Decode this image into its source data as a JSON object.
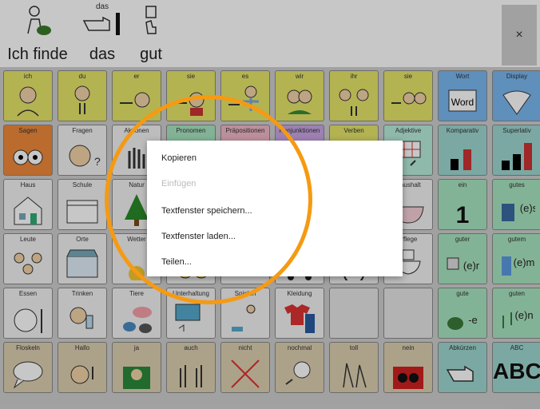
{
  "message_bar": {
    "words": [
      {
        "text": "Ich finde",
        "small": "",
        "icon": "finder-person-icon"
      },
      {
        "text": "das",
        "small": "das",
        "icon": "pointing-hand-icon"
      },
      {
        "text": "gut",
        "small": "",
        "icon": "thumb-up-icon"
      }
    ],
    "close_label": "×"
  },
  "grid": {
    "rows": [
      [
        {
          "label": "ich",
          "color": "yellow",
          "icon": "person-self-icon"
        },
        {
          "label": "du",
          "color": "yellow",
          "icon": "person-you-icon"
        },
        {
          "label": "er",
          "color": "yellow",
          "icon": "point-boy-icon"
        },
        {
          "label": "sie",
          "color": "yellow",
          "icon": "point-girl-icon"
        },
        {
          "label": "es",
          "color": "yellow",
          "icon": "point-child-icon"
        },
        {
          "label": "wir",
          "color": "yellow",
          "icon": "group-we-icon"
        },
        {
          "label": "ihr",
          "color": "yellow",
          "icon": "group-you-icon"
        },
        {
          "label": "sie",
          "color": "yellow",
          "icon": "group-they-icon"
        },
        {
          "label": "Wort",
          "color": "blue",
          "icon": "word-card-icon"
        },
        {
          "label": "Display",
          "color": "blue",
          "icon": "fan-display-icon"
        }
      ],
      [
        {
          "label": "Sagen",
          "color": "orange",
          "icon": "look-eyes-icon"
        },
        {
          "label": "Fragen",
          "color": "white",
          "icon": "question-face-icon"
        },
        {
          "label": "Aktionen",
          "color": "white",
          "icon": "hand-wave-icon"
        },
        {
          "label": "Pronomen",
          "color": "green",
          "icon": ""
        },
        {
          "label": "Präpositionen",
          "color": "pink",
          "icon": ""
        },
        {
          "label": "Konjunktionen",
          "color": "purple",
          "icon": ""
        },
        {
          "label": "Verben",
          "color": "yellow",
          "icon": ""
        },
        {
          "label": "Adjektive",
          "color": "mint",
          "icon": "grid-adjective-icon"
        },
        {
          "label": "Komparativ",
          "color": "teal",
          "icon": "bars-compare-icon"
        },
        {
          "label": "Superlativ",
          "color": "teal",
          "icon": "bars-superlative-icon"
        }
      ],
      [
        {
          "label": "Haus",
          "color": "white",
          "icon": "house-icon"
        },
        {
          "label": "Schule",
          "color": "white",
          "icon": "school-icon"
        },
        {
          "label": "Natur",
          "color": "white",
          "icon": "tree-icon"
        },
        {
          "label": "",
          "color": "white",
          "icon": ""
        },
        {
          "label": "",
          "color": "white",
          "icon": ""
        },
        {
          "label": "",
          "color": "white",
          "icon": ""
        },
        {
          "label": "",
          "color": "white",
          "icon": ""
        },
        {
          "label": "Haushalt",
          "color": "white",
          "icon": "bowl-icon"
        },
        {
          "label": "ein",
          "color": "green",
          "icon": "number-one-icon"
        },
        {
          "label": "gutes",
          "color": "green",
          "icon": "book-ending-icon"
        }
      ],
      [
        {
          "label": "Leute",
          "color": "white",
          "icon": "people-icon"
        },
        {
          "label": "Orte",
          "color": "white",
          "icon": "shop-icon"
        },
        {
          "label": "Wetter",
          "color": "white",
          "icon": "sun-icon"
        },
        {
          "label": "",
          "color": "white",
          "icon": "faces-icon"
        },
        {
          "label": "",
          "color": "white",
          "icon": ""
        },
        {
          "label": "",
          "color": "white",
          "icon": "car-icon"
        },
        {
          "label": "",
          "color": "white",
          "icon": "ball-icon"
        },
        {
          "label": "Pflege",
          "color": "white",
          "icon": "toilet-icon"
        },
        {
          "label": "guter",
          "color": "green",
          "icon": "robot-ending-icon"
        },
        {
          "label": "gutem",
          "color": "green",
          "icon": "milk-ending-icon"
        }
      ],
      [
        {
          "label": "Essen",
          "color": "white",
          "icon": "plate-icon"
        },
        {
          "label": "Trinken",
          "color": "white",
          "icon": "drink-icon"
        },
        {
          "label": "Tiere",
          "color": "white",
          "icon": "animals-icon"
        },
        {
          "label": "Unterhaltung",
          "color": "white",
          "icon": "tv-icon"
        },
        {
          "label": "Spielen",
          "color": "white",
          "icon": "play-icon"
        },
        {
          "label": "Kleidung",
          "color": "white",
          "icon": "clothes-icon"
        },
        {
          "label": "",
          "color": "empty",
          "icon": ""
        },
        {
          "label": "",
          "color": "empty",
          "icon": ""
        },
        {
          "label": "gute",
          "color": "green",
          "icon": "duck-ending-icon"
        },
        {
          "label": "guten",
          "color": "green",
          "icon": "music-ending-icon"
        }
      ],
      [
        {
          "label": "Floskeln",
          "color": "tan",
          "icon": "speech-bubble-icon"
        },
        {
          "label": "Hallo",
          "color": "tan",
          "icon": "wave-face-icon"
        },
        {
          "label": "ja",
          "color": "tan",
          "icon": "yes-icon"
        },
        {
          "label": "auch",
          "color": "tan",
          "icon": "also-hands-icon"
        },
        {
          "label": "nicht",
          "color": "tan",
          "icon": "cross-icon"
        },
        {
          "label": "nochmal",
          "color": "tan",
          "icon": "again-icon"
        },
        {
          "label": "toll",
          "color": "tan",
          "icon": "clap-icon"
        },
        {
          "label": "nein",
          "color": "tan",
          "icon": "no-icon"
        },
        {
          "label": "Abkürzen",
          "color": "teal",
          "icon": "point-hand-icon"
        },
        {
          "label": "ABC",
          "color": "teal",
          "icon": "abc-icon"
        }
      ]
    ]
  },
  "context_menu": {
    "items": [
      {
        "label": "Kopieren",
        "enabled": true
      },
      {
        "label": "Einfügen",
        "enabled": false
      },
      {
        "label": "Textfenster speichern...",
        "enabled": true
      },
      {
        "label": "Textfenster laden...",
        "enabled": true
      },
      {
        "label": "Teilen...",
        "enabled": true
      }
    ]
  },
  "colors": {
    "highlight_ring": "#f59a12",
    "overlay_dim": "rgba(0,0,0,0.22)"
  }
}
